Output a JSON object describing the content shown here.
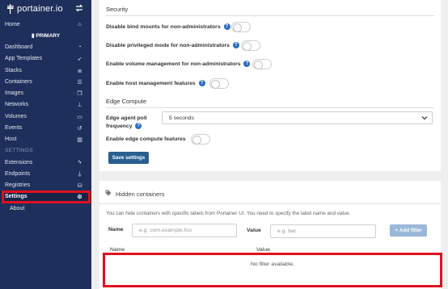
{
  "sidebar": {
    "logo_text": "portainer.io",
    "items": [
      {
        "label": "Home",
        "icon": "home-icon"
      },
      {
        "label": "Dashboard",
        "icon": "dashboard-icon"
      },
      {
        "label": "App Templates",
        "icon": "rocket-icon"
      },
      {
        "label": "Stacks",
        "icon": "stacks-icon"
      },
      {
        "label": "Containers",
        "icon": "list-icon"
      },
      {
        "label": "Images",
        "icon": "clone-icon"
      },
      {
        "label": "Networks",
        "icon": "sitemap-icon"
      },
      {
        "label": "Volumes",
        "icon": "hdd-icon"
      },
      {
        "label": "Events",
        "icon": "history-icon"
      },
      {
        "label": "Host",
        "icon": "server-icon"
      },
      {
        "label": "Extensions",
        "icon": "bolt-icon"
      },
      {
        "label": "Endpoints",
        "icon": "plug-icon"
      },
      {
        "label": "Registries",
        "icon": "database-icon"
      },
      {
        "label": "Settings",
        "icon": "cogs-icon"
      },
      {
        "label": "About",
        "icon": ""
      }
    ],
    "endpoint": "PRIMARY",
    "settings_section": "SETTINGS"
  },
  "security": {
    "title": "Security",
    "rows": [
      "Disable bind mounts for non-administrators",
      "Disable privileged mode for non-administrators",
      "Enable volume management for non-administrators",
      "Enable host management features"
    ]
  },
  "edge": {
    "title": "Edge Compute",
    "poll_label_1": "Edge agent poll",
    "poll_label_2": "frequency",
    "poll_value": "5 seconds",
    "edge_features_label": "Enable edge compute features"
  },
  "save_button": "Save settings",
  "hidden": {
    "title": "Hidden containers",
    "info": "You can hide containers with specific labels from Portainer UI. You need to specify the label name and value.",
    "name_label": "Name",
    "name_placeholder": "e.g. com.example.foo",
    "value_label": "Value",
    "value_placeholder": "e.g. bar",
    "add_button": "Add filter",
    "col_name": "Name",
    "col_value": "Value",
    "empty_text": "No filter available."
  },
  "colors": {
    "sidebar_bg": "#1e2f5c",
    "primary": "#286090",
    "highlight": "#e01020"
  }
}
